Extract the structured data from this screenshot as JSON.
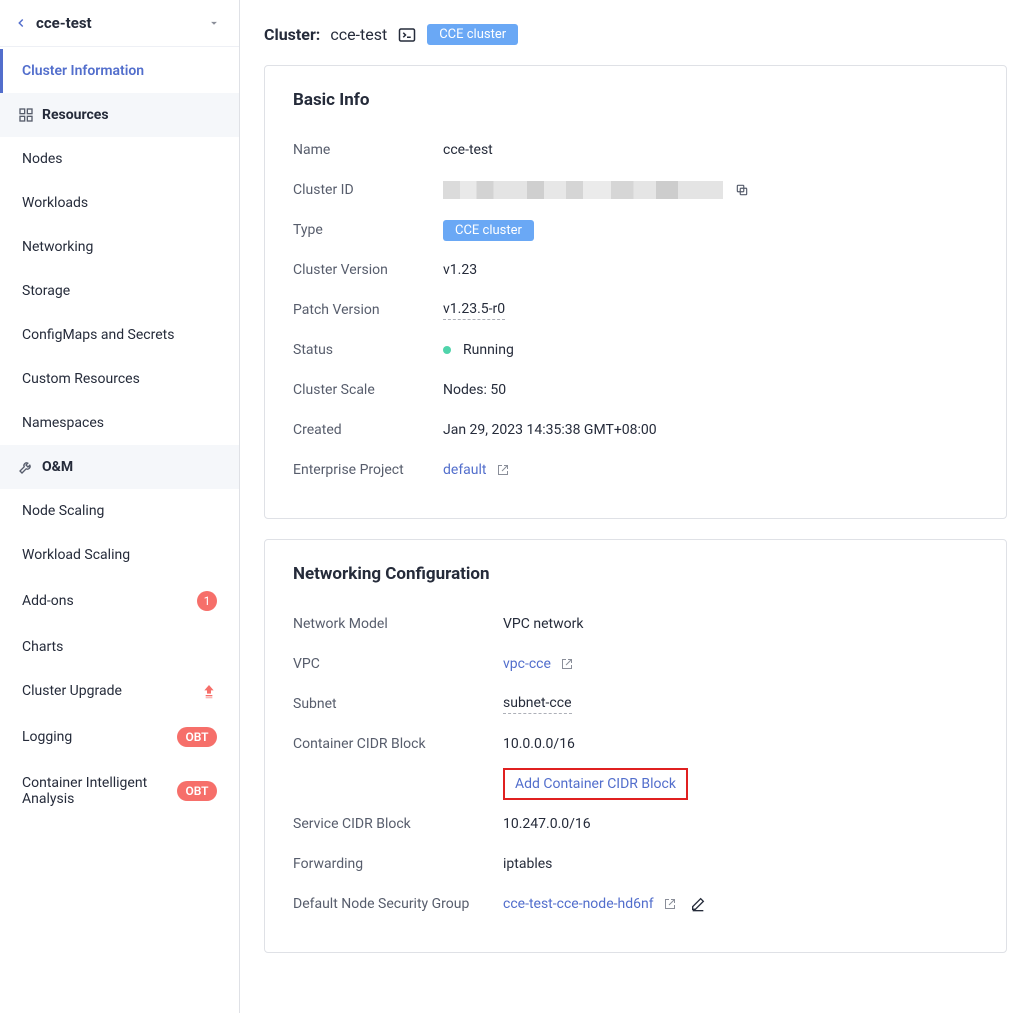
{
  "header": {
    "back_aria": "Back",
    "title": "cce-test"
  },
  "sidebar": {
    "cluster_info": "Cluster Information",
    "group_resources": "Resources",
    "group_om": "O&M",
    "items": {
      "nodes": "Nodes",
      "workloads": "Workloads",
      "networking": "Networking",
      "storage": "Storage",
      "configmaps": "ConfigMaps and Secrets",
      "custom_resources": "Custom Resources",
      "namespaces": "Namespaces",
      "node_scaling": "Node Scaling",
      "workload_scaling": "Workload Scaling",
      "addons": "Add-ons",
      "charts": "Charts",
      "cluster_upgrade": "Cluster Upgrade",
      "logging": "Logging",
      "cia": "Container Intelligent Analysis"
    },
    "badges": {
      "addons": "1",
      "obt": "OBT"
    }
  },
  "titlebar": {
    "prefix": "Cluster:",
    "name": "cce-test",
    "pill": "CCE cluster"
  },
  "basic": {
    "heading": "Basic Info",
    "labels": {
      "name": "Name",
      "cluster_id": "Cluster ID",
      "type": "Type",
      "cluster_version": "Cluster Version",
      "patch_version": "Patch Version",
      "status": "Status",
      "cluster_scale": "Cluster Scale",
      "created": "Created",
      "enterprise_project": "Enterprise Project"
    },
    "values": {
      "name": "cce-test",
      "type_pill": "CCE cluster",
      "cluster_version": "v1.23",
      "patch_version": "v1.23.5-r0",
      "status": "Running",
      "cluster_scale": "Nodes: 50",
      "created": "Jan 29, 2023 14:35:38 GMT+08:00",
      "enterprise_project": "default"
    }
  },
  "networking": {
    "heading": "Networking Configuration",
    "labels": {
      "network_model": "Network Model",
      "vpc": "VPC",
      "subnet": "Subnet",
      "container_cidr": "Container CIDR Block",
      "add_cidr": "Add Container CIDR Block",
      "service_cidr": "Service CIDR Block",
      "forwarding": "Forwarding",
      "default_sg": "Default Node Security Group"
    },
    "values": {
      "network_model": "VPC network",
      "vpc": "vpc-cce",
      "subnet": "subnet-cce",
      "container_cidr": "10.0.0.0/16",
      "service_cidr": "10.247.0.0/16",
      "forwarding": "iptables",
      "default_sg": "cce-test-cce-node-hd6nf"
    }
  }
}
